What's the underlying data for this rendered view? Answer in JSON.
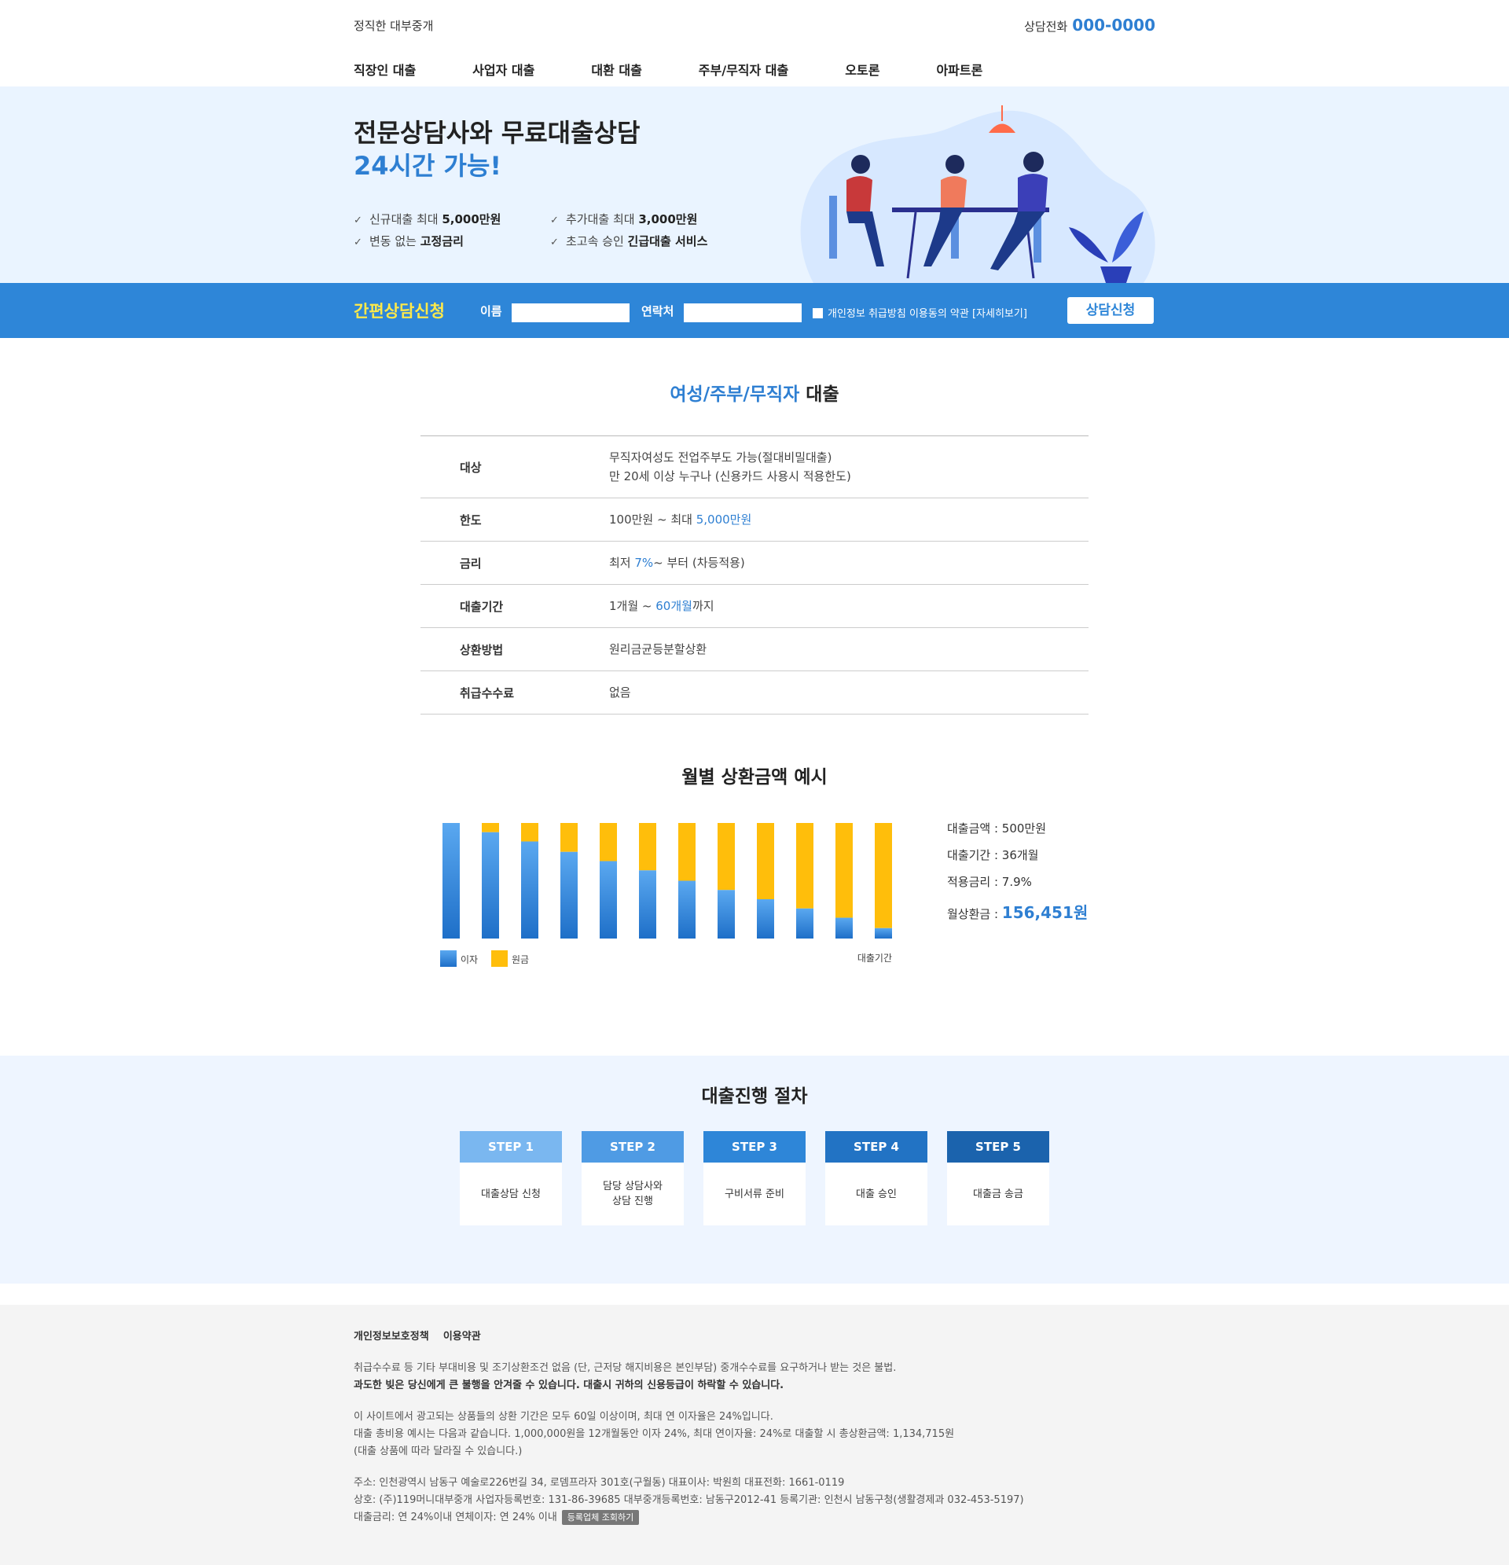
{
  "header": {
    "brand": "정직한 대부중개",
    "phone_label": "상담전화",
    "phone_number": "000-0000",
    "nav": [
      "직장인 대출",
      "사업자 대출",
      "대환 대출",
      "주부/무직자 대출",
      "오토론",
      "아파트론"
    ]
  },
  "hero": {
    "title": "전문상담사와 무료대출상담",
    "subtitle": "24시간 가능!",
    "features": [
      {
        "text": "신규대출 최대 ",
        "bold": "5,000만원"
      },
      {
        "text": "추가대출 최대 ",
        "bold": "3,000만원"
      },
      {
        "text": "변동 없는 ",
        "bold": "고정금리"
      },
      {
        "text": "초고속 승인 ",
        "bold": "긴급대출 서비스"
      }
    ]
  },
  "consult": {
    "title": "간편상담신청",
    "name_label": "이름",
    "contact_label": "연락처",
    "agree_text": "개인정보 취급방침 이용동의 약관 [자세히보기]",
    "apply_label": "상담신청"
  },
  "product": {
    "title_highlight": "여성/주부/무직자",
    "title_rest": " 대출",
    "rows": [
      {
        "key": "대상",
        "line1": "무직자여성도 전업주부도 가능(절대비밀대출)",
        "line2": "만 20세 이상 누구나 (신용카드 사용시 적용한도)"
      },
      {
        "key": "한도",
        "pre": "100만원 ~ 최대 ",
        "blue": "5,000만원",
        "post": ""
      },
      {
        "key": "금리",
        "pre": "최저 ",
        "blue": "7%",
        "post": "~ 부터 (차등적용)"
      },
      {
        "key": "대출기간",
        "pre": "1개월 ~ ",
        "blue": "60개월",
        "post": "까지"
      },
      {
        "key": "상환방법",
        "pre": "원리금균등분할상환",
        "blue": "",
        "post": ""
      },
      {
        "key": "취급수수료",
        "pre": "없음",
        "blue": "",
        "post": ""
      }
    ]
  },
  "chart_data": {
    "type": "bar",
    "title": "월별 상환금액 예시",
    "stacked": true,
    "series": [
      {
        "name": "이자",
        "color": "#2e86d8",
        "values": [
          1.0,
          0.92,
          0.84,
          0.75,
          0.67,
          0.59,
          0.5,
          0.42,
          0.34,
          0.26,
          0.18,
          0.09
        ]
      },
      {
        "name": "원금",
        "color": "#ffbe0b",
        "values": [
          0.0,
          0.08,
          0.16,
          0.25,
          0.33,
          0.41,
          0.5,
          0.58,
          0.66,
          0.74,
          0.82,
          0.91
        ]
      }
    ],
    "xlabel": "대출기간",
    "legend": "bottom-left"
  },
  "summary": {
    "amount_label": "대출금액 : ",
    "amount": "500만원",
    "period_label": "대출기간 : ",
    "period": "36개월",
    "rate_label": "적용금리 : ",
    "rate": "7.9%",
    "monthly_label": "월상환금 : ",
    "monthly": "156,451원"
  },
  "procedure": {
    "title": "대출진행 절차",
    "steps": [
      {
        "label": "STEP 1",
        "desc": "대출상담 신청",
        "color": "#7ab7f0"
      },
      {
        "label": "STEP 2",
        "desc": "담당 상담사와\n상담 진행",
        "color": "#4f9be4"
      },
      {
        "label": "STEP 3",
        "desc": "구비서류 준비",
        "color": "#2e86d8"
      },
      {
        "label": "STEP 4",
        "desc": "대출 승인",
        "color": "#2273c4"
      },
      {
        "label": "STEP 5",
        "desc": "대출금 송금",
        "color": "#1b63ad"
      }
    ]
  },
  "footer": {
    "link1": "개인정보보호정책",
    "link2": "이용약관",
    "p1_line1": "취급수수료 등 기타 부대비용 및 조기상환조건 없음 (단, 근저당 해지비용은 본인부담) 중개수수료를 요구하거나 받는 것은 불법.",
    "p1_line2": "과도한 빚은 당신에게 큰 불행을 안겨줄 수 있습니다. 대출시 귀하의 신용등급이 하락할 수 있습니다.",
    "p2_line1": "이 사이트에서 광고되는 상품들의 상환 기간은 모두 60일 이상이며, 최대 연 이자율은 24%입니다.",
    "p2_line2": "대출 총비용 예시는 다음과 같습니다. 1,000,000원을 12개월동안 이자 24%, 최대 연이자율: 24%로 대출할 시 총상환금액: 1,134,715원",
    "p2_line3": "(대출 상품에 따라 달라질 수 있습니다.)",
    "p3_line1": "주소: 인천광역시 남동구 예술로226번길 34, 로뎀프라자 301호(구월동)   대표이사: 박원희   대표전화: 1661-0119",
    "p3_line2": "상호: (주)119머니대부중개   사업자등록번호: 131-86-39685 대부중개등록번호: 남동구2012-41   등록기관: 인천시 남동구청(생활경제과 032-453-5197)",
    "p3_line3": "대출금리: 연 24%이내   연체이자: 연 24% 이내",
    "lookup": "등록업체 조회하기"
  }
}
